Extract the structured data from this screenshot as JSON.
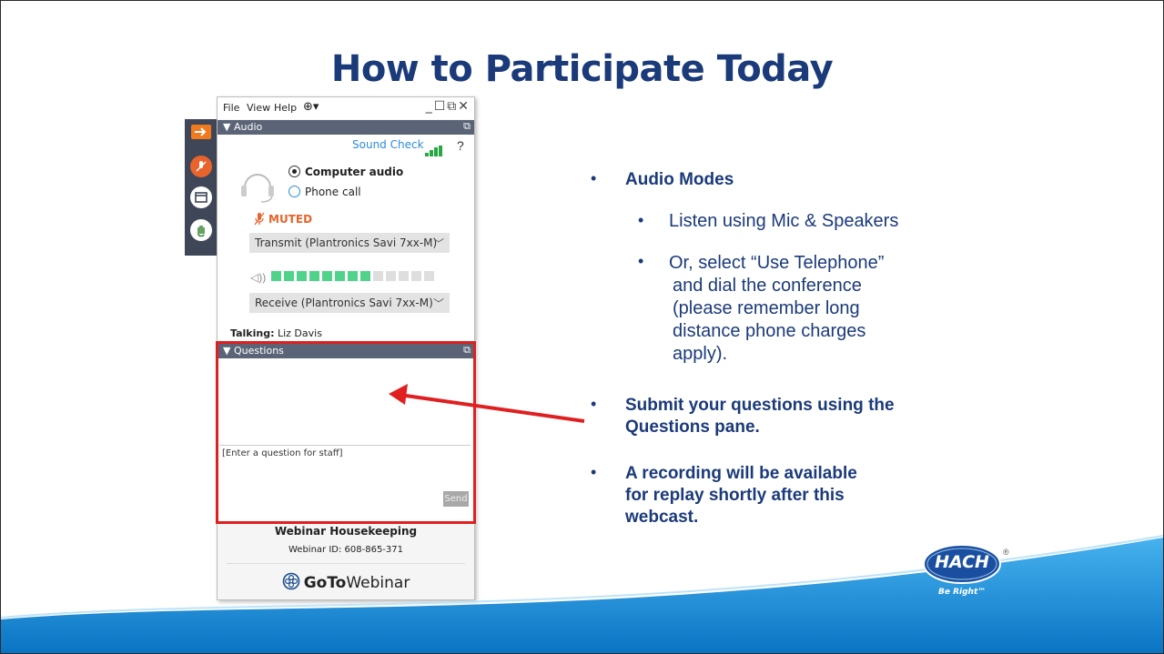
{
  "slide": {
    "title": "How to Participate Today"
  },
  "window": {
    "menu": {
      "file": "File",
      "view": "View",
      "help": "Help",
      "window_controls": "_☐⧉✕"
    },
    "audio_section": {
      "header": "Audio",
      "sound_check": "Sound Check",
      "help_glyph": "?",
      "options": [
        {
          "label": "Computer audio",
          "selected": true
        },
        {
          "label": "Phone call",
          "selected": false
        }
      ],
      "status": "MUTED",
      "transmit_device": "Transmit (Plantronics Savi 7xx-M)",
      "receive_device": "Receive (Plantronics Savi 7xx-M)",
      "volume_level_fraction": 0.615,
      "talking_label": "Talking:",
      "talking_name": "Liz Davis"
    },
    "questions_section": {
      "header": "Questions",
      "input_placeholder": "[Enter a question for staff]",
      "send_label": "Send"
    },
    "footer": {
      "title": "Webinar Housekeeping",
      "webinar_id": "Webinar ID: 608-865-371",
      "brand_bold": "GoTo",
      "brand_rest": "Webinar"
    }
  },
  "bullets": {
    "audio_modes": "Audio Modes",
    "sub1": "Listen using Mic & Speakers",
    "sub2_lines": [
      "Or, select “Use Telephone”",
      "and dial the conference",
      "(please remember long",
      "distance phone charges",
      "apply)."
    ],
    "questions_lines": [
      "Submit your questions using the",
      "Questions pane."
    ],
    "recording_lines": [
      "A recording will be available",
      "for replay shortly after this",
      "webcast."
    ]
  },
  "logo": {
    "name": "HACH",
    "tagline": "Be Right™",
    "registered": "®"
  },
  "colors": {
    "title": "#1b3a7a",
    "accent_red": "#e02020",
    "muted_orange": "#e8642c",
    "wave_blue": "#1a8fd8"
  }
}
